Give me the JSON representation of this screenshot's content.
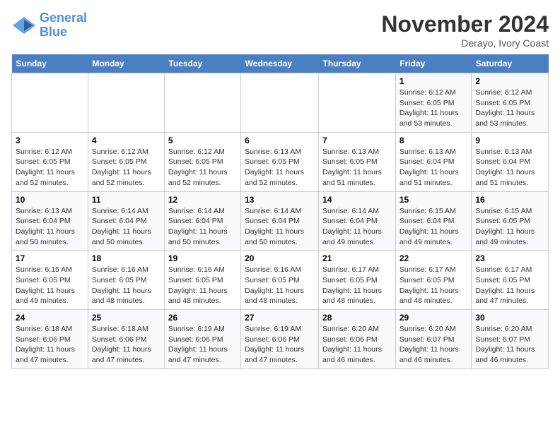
{
  "logo": {
    "line1": "General",
    "line2": "Blue"
  },
  "title": "November 2024",
  "subtitle": "Derayo, Ivory Coast",
  "days_of_week": [
    "Sunday",
    "Monday",
    "Tuesday",
    "Wednesday",
    "Thursday",
    "Friday",
    "Saturday"
  ],
  "weeks": [
    [
      {
        "day": "",
        "info": ""
      },
      {
        "day": "",
        "info": ""
      },
      {
        "day": "",
        "info": ""
      },
      {
        "day": "",
        "info": ""
      },
      {
        "day": "",
        "info": ""
      },
      {
        "day": "1",
        "info": "Sunrise: 6:12 AM\nSunset: 6:05 PM\nDaylight: 11 hours and 53 minutes."
      },
      {
        "day": "2",
        "info": "Sunrise: 6:12 AM\nSunset: 6:05 PM\nDaylight: 11 hours and 53 minutes."
      }
    ],
    [
      {
        "day": "3",
        "info": "Sunrise: 6:12 AM\nSunset: 6:05 PM\nDaylight: 11 hours and 52 minutes."
      },
      {
        "day": "4",
        "info": "Sunrise: 6:12 AM\nSunset: 6:05 PM\nDaylight: 11 hours and 52 minutes."
      },
      {
        "day": "5",
        "info": "Sunrise: 6:12 AM\nSunset: 6:05 PM\nDaylight: 11 hours and 52 minutes."
      },
      {
        "day": "6",
        "info": "Sunrise: 6:13 AM\nSunset: 6:05 PM\nDaylight: 11 hours and 52 minutes."
      },
      {
        "day": "7",
        "info": "Sunrise: 6:13 AM\nSunset: 6:05 PM\nDaylight: 11 hours and 51 minutes."
      },
      {
        "day": "8",
        "info": "Sunrise: 6:13 AM\nSunset: 6:04 PM\nDaylight: 11 hours and 51 minutes."
      },
      {
        "day": "9",
        "info": "Sunrise: 6:13 AM\nSunset: 6:04 PM\nDaylight: 11 hours and 51 minutes."
      }
    ],
    [
      {
        "day": "10",
        "info": "Sunrise: 6:13 AM\nSunset: 6:04 PM\nDaylight: 11 hours and 50 minutes."
      },
      {
        "day": "11",
        "info": "Sunrise: 6:14 AM\nSunset: 6:04 PM\nDaylight: 11 hours and 50 minutes."
      },
      {
        "day": "12",
        "info": "Sunrise: 6:14 AM\nSunset: 6:04 PM\nDaylight: 11 hours and 50 minutes."
      },
      {
        "day": "13",
        "info": "Sunrise: 6:14 AM\nSunset: 6:04 PM\nDaylight: 11 hours and 50 minutes."
      },
      {
        "day": "14",
        "info": "Sunrise: 6:14 AM\nSunset: 6:04 PM\nDaylight: 11 hours and 49 minutes."
      },
      {
        "day": "15",
        "info": "Sunrise: 6:15 AM\nSunset: 6:04 PM\nDaylight: 11 hours and 49 minutes."
      },
      {
        "day": "16",
        "info": "Sunrise: 6:15 AM\nSunset: 6:05 PM\nDaylight: 11 hours and 49 minutes."
      }
    ],
    [
      {
        "day": "17",
        "info": "Sunrise: 6:15 AM\nSunset: 6:05 PM\nDaylight: 11 hours and 49 minutes."
      },
      {
        "day": "18",
        "info": "Sunrise: 6:16 AM\nSunset: 6:05 PM\nDaylight: 11 hours and 48 minutes."
      },
      {
        "day": "19",
        "info": "Sunrise: 6:16 AM\nSunset: 6:05 PM\nDaylight: 11 hours and 48 minutes."
      },
      {
        "day": "20",
        "info": "Sunrise: 6:16 AM\nSunset: 6:05 PM\nDaylight: 11 hours and 48 minutes."
      },
      {
        "day": "21",
        "info": "Sunrise: 6:17 AM\nSunset: 6:05 PM\nDaylight: 11 hours and 48 minutes."
      },
      {
        "day": "22",
        "info": "Sunrise: 6:17 AM\nSunset: 6:05 PM\nDaylight: 11 hours and 48 minutes."
      },
      {
        "day": "23",
        "info": "Sunrise: 6:17 AM\nSunset: 6:05 PM\nDaylight: 11 hours and 47 minutes."
      }
    ],
    [
      {
        "day": "24",
        "info": "Sunrise: 6:18 AM\nSunset: 6:06 PM\nDaylight: 11 hours and 47 minutes."
      },
      {
        "day": "25",
        "info": "Sunrise: 6:18 AM\nSunset: 6:06 PM\nDaylight: 11 hours and 47 minutes."
      },
      {
        "day": "26",
        "info": "Sunrise: 6:19 AM\nSunset: 6:06 PM\nDaylight: 11 hours and 47 minutes."
      },
      {
        "day": "27",
        "info": "Sunrise: 6:19 AM\nSunset: 6:06 PM\nDaylight: 11 hours and 47 minutes."
      },
      {
        "day": "28",
        "info": "Sunrise: 6:20 AM\nSunset: 6:06 PM\nDaylight: 11 hours and 46 minutes."
      },
      {
        "day": "29",
        "info": "Sunrise: 6:20 AM\nSunset: 6:07 PM\nDaylight: 11 hours and 46 minutes."
      },
      {
        "day": "30",
        "info": "Sunrise: 6:20 AM\nSunset: 6:07 PM\nDaylight: 11 hours and 46 minutes."
      }
    ]
  ]
}
